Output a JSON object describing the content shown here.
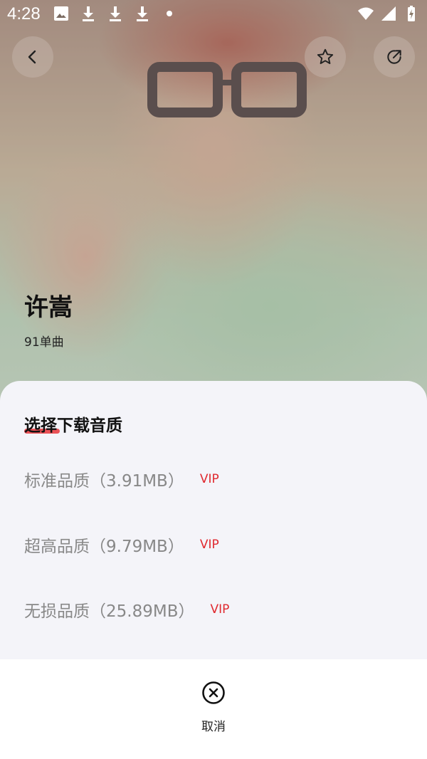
{
  "status_bar": {
    "time": "4:28",
    "notification_icons": [
      "image-icon",
      "download-icon",
      "download-icon",
      "download-icon",
      "dot-icon"
    ],
    "system_icons": [
      "wifi-icon",
      "signal-icon",
      "battery-charging-icon"
    ]
  },
  "header": {
    "back_icon": "chevron-left-icon",
    "favorite_icon": "star-outline-icon",
    "share_icon": "share-icon"
  },
  "artist": {
    "name": "许嵩",
    "song_count": "91单曲"
  },
  "download_sheet": {
    "title": "选择下载音质",
    "accent_color": "#e8343a",
    "options": [
      {
        "label": "标准品质（3.91MB）",
        "badge": "VIP"
      },
      {
        "label": "超高品质（9.79MB）",
        "badge": "VIP"
      },
      {
        "label": "无损品质（25.89MB）",
        "badge": "VIP"
      }
    ],
    "cancel_label": "取消",
    "cancel_icon": "close-circle-icon"
  }
}
